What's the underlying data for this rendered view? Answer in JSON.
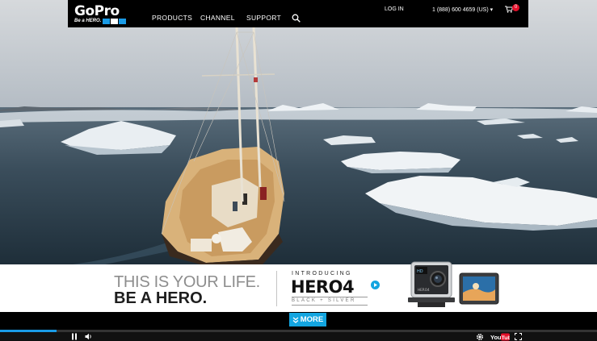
{
  "brand": {
    "logo_text": "GoPro",
    "logo_tagline": "Be a HERO.",
    "logo_colors": [
      "#1a9be6",
      "#ffffff",
      "#1a9be6"
    ]
  },
  "nav": {
    "items": [
      {
        "label": "PRODUCTS"
      },
      {
        "label": "CHANNEL"
      },
      {
        "label": "SUPPORT"
      }
    ],
    "search_icon": "search-icon",
    "login_label": "LOG IN",
    "phone_label": "1 (888) 600 4659 (US) ▾",
    "cart_icon": "cart-icon",
    "cart_count": "0"
  },
  "video": {
    "scene": "sailboat among icebergs"
  },
  "banner": {
    "headline_line1": "THIS IS YOUR LIFE.",
    "headline_line2": "BE A HERO.",
    "intro_label": "INTRODUCING",
    "product_name": "HERO4",
    "product_variant": "BLACK + SILVER"
  },
  "more_button": {
    "icon": "chevron-double-down-icon",
    "label": "MORE"
  },
  "player": {
    "progress_fraction": 0.095,
    "youtube_label": "YouTube"
  },
  "colors": {
    "accent_blue": "#13a5e0",
    "progress_blue": "#1a9be6",
    "cart_badge_red": "#e4102a",
    "headline_gray": "#8d8d8d",
    "headline_dark": "#1e1e1e"
  }
}
